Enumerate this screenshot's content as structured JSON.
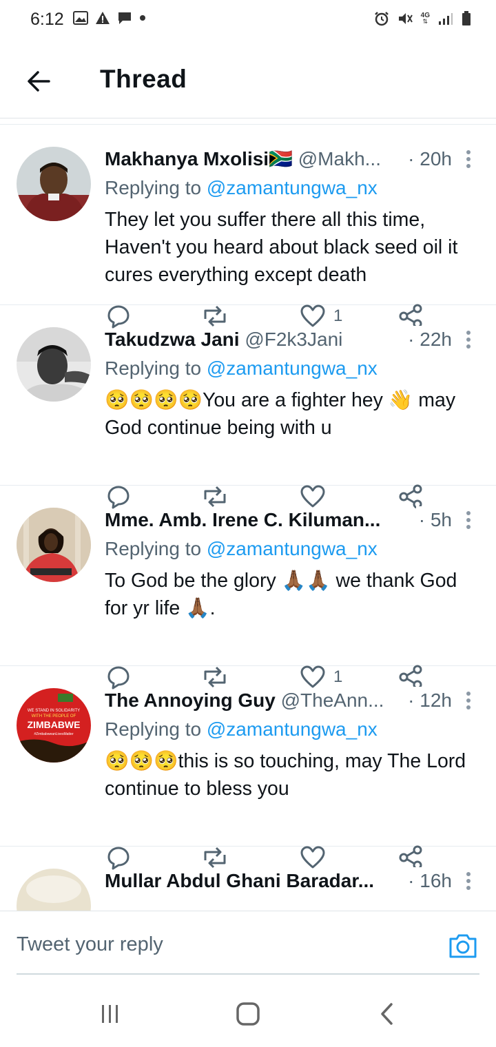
{
  "status_bar": {
    "time": "6:12",
    "left_icons": [
      "image-icon",
      "warning-icon",
      "chat-bubble-icon",
      "dot-icon"
    ],
    "right_icons": [
      "alarm-icon",
      "mute-icon",
      "network-4g-icon",
      "signal-icon",
      "battery-icon"
    ],
    "network_label": "4G"
  },
  "header": {
    "title": "Thread"
  },
  "tweets": [
    {
      "name": "Makhanya Mxolisi",
      "name_flag": "🇿🇦",
      "handle": "@Makh...",
      "time": "· 20h",
      "reply_prefix": "Replying to",
      "reply_to": "@zamantungwa_nx",
      "text": "They let you suffer there all this time, Haven't you heard about black seed oil it cures everything except death",
      "like_count": "1"
    },
    {
      "name": "Takudzwa Jani",
      "name_flag": "",
      "handle": "@F2k3Jani",
      "time": "· 22h",
      "reply_prefix": "Replying to",
      "reply_to": "@zamantungwa_nx",
      "text": "🥺🥺🥺🥺You are a fighter hey 👋 may God continue being with u",
      "like_count": ""
    },
    {
      "name": "Mme. Amb. Irene C. Kiluman...",
      "name_flag": "",
      "handle": "",
      "time": "· 5h",
      "reply_prefix": "Replying to",
      "reply_to": "@zamantungwa_nx",
      "text": "To God be the glory 🙏🏾🙏🏾 we thank God for yr life 🙏🏾.",
      "like_count": "1"
    },
    {
      "name": "The Annoying Guy",
      "name_flag": "",
      "handle": "@TheAnn...",
      "time": "· 12h",
      "reply_prefix": "Replying to",
      "reply_to": "@zamantungwa_nx",
      "text": "🥺🥺🥺this is so touching, may The Lord continue to bless you",
      "like_count": ""
    },
    {
      "name": "Mullar Abdul Ghani Baradar...",
      "name_flag": "",
      "handle": "",
      "time": "· 16h",
      "reply_prefix": "",
      "reply_to": "",
      "text": "",
      "like_count": ""
    }
  ],
  "avatar_texts": {
    "line1": "WE STAND IN SOLIDARITY",
    "line2": "WITH THE PEOPLE OF",
    "line3": "ZIMBABWE",
    "line4": "#ZimbabweanLivesMatter"
  },
  "reply_bar": {
    "placeholder": "Tweet your reply"
  },
  "colors": {
    "accent": "#1d9bf0",
    "text_secondary": "#536471",
    "text_primary": "#0f1419",
    "divider": "#e6ecf0"
  }
}
